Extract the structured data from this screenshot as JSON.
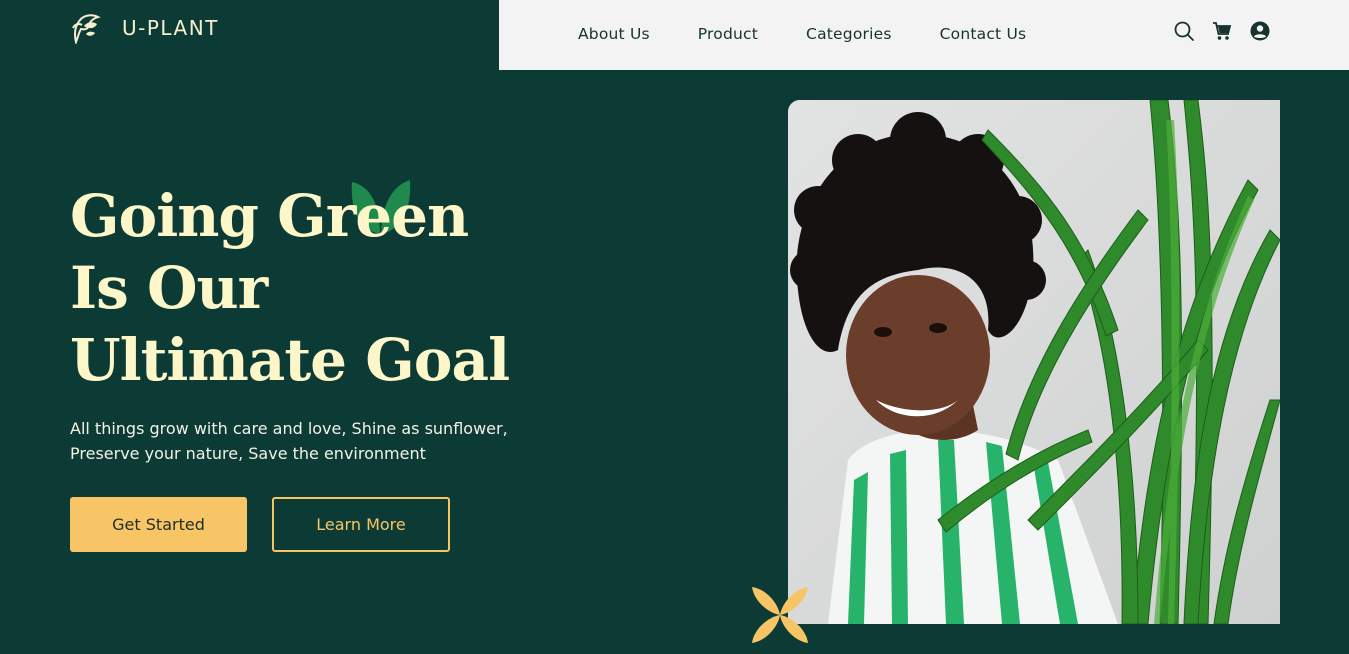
{
  "brand": {
    "name": "U-PLANT",
    "icon": "plant-logo-icon"
  },
  "nav": {
    "links": [
      "About Us",
      "Product",
      "Categories",
      "Contact Us"
    ],
    "icons": [
      "search-icon",
      "cart-icon",
      "account-icon"
    ]
  },
  "hero": {
    "title_lines": [
      "Going Green",
      "Is Our",
      "Ultimate Goal"
    ],
    "subtitle_lines": [
      "All things grow with care and love, Shine as sunflower,",
      "Preserve your nature, Save the environment"
    ],
    "primary_button": "Get Started",
    "secondary_button": "Learn More"
  },
  "colors": {
    "background": "#0c3b35",
    "navbar": "#f3f3f3",
    "title": "#fdf6c9",
    "accent": "#f7c566",
    "leaf": "#1f8a4c"
  }
}
